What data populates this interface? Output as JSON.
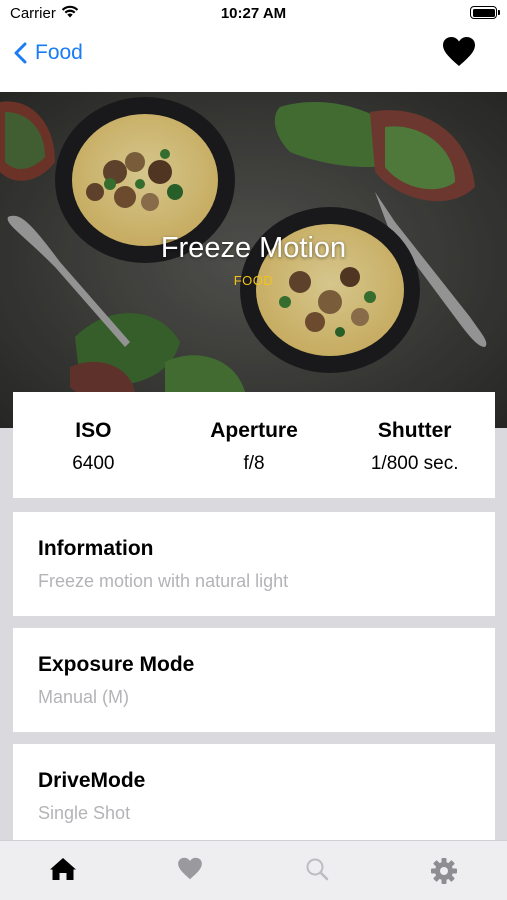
{
  "status_bar": {
    "carrier": "Carrier",
    "time": "10:27 AM",
    "icons": [
      "wifi-icon",
      "battery-icon"
    ]
  },
  "nav": {
    "back_label": "Food",
    "back_icon": "chevron-left-icon",
    "favorite_icon": "heart-icon",
    "accent_color": "#1a7cf5"
  },
  "hero": {
    "title": "Freeze Motion",
    "subtitle": "FOOD",
    "subtitle_color": "#f2c318"
  },
  "camera_settings": [
    {
      "label": "ISO",
      "value": "6400"
    },
    {
      "label": "Aperture",
      "value": "f/8"
    },
    {
      "label": "Shutter",
      "value": "1/800 sec."
    }
  ],
  "details": [
    {
      "title": "Information",
      "value": "Freeze motion with natural light"
    },
    {
      "title": "Exposure Mode",
      "value": "Manual (M)"
    },
    {
      "title": "DriveMode",
      "value": "Single Shot"
    }
  ],
  "tab_bar": {
    "tabs": [
      {
        "name": "home",
        "icon": "home-icon",
        "active": true
      },
      {
        "name": "favorites",
        "icon": "heart-icon",
        "active": false
      },
      {
        "name": "search",
        "icon": "search-icon",
        "active": false
      },
      {
        "name": "settings",
        "icon": "gear-icon",
        "active": false
      }
    ]
  }
}
